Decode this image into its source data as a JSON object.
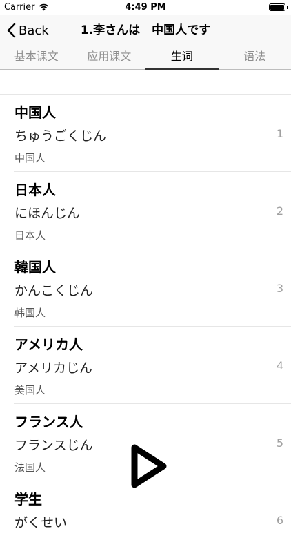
{
  "status": {
    "carrier": "Carrier",
    "time": "4:49 PM",
    "battery_level": 1.0
  },
  "nav": {
    "back_label": "Back",
    "title": "1.李さんは　中国人です"
  },
  "tabs": [
    {
      "label": "基本课文",
      "active": false
    },
    {
      "label": "应用课文",
      "active": false
    },
    {
      "label": "生词",
      "active": true
    },
    {
      "label": "语法",
      "active": false
    }
  ],
  "words": [
    {
      "word": "中国人",
      "reading": "ちゅうごくじん",
      "meaning": "中国人",
      "num": "1"
    },
    {
      "word": "日本人",
      "reading": "にほんじん",
      "meaning": "日本人",
      "num": "2"
    },
    {
      "word": "韓国人",
      "reading": "かんこくじん",
      "meaning": "韩国人",
      "num": "3"
    },
    {
      "word": "アメリカ人",
      "reading": "アメリカじん",
      "meaning": "美国人",
      "num": "4"
    },
    {
      "word": "フランス人",
      "reading": "フランスじん",
      "meaning": "法国人",
      "num": "5"
    },
    {
      "word": "学生",
      "reading": "がくせい",
      "meaning": "",
      "num": "6"
    }
  ],
  "icons": {
    "wifi": "wifi-icon",
    "battery": "battery-icon",
    "back": "chevron-left-icon",
    "play": "play-icon"
  },
  "colors": {
    "tab_indicator": "#333333",
    "separator": "#e6e6e6",
    "nav_bg": "#f8f8f8"
  }
}
